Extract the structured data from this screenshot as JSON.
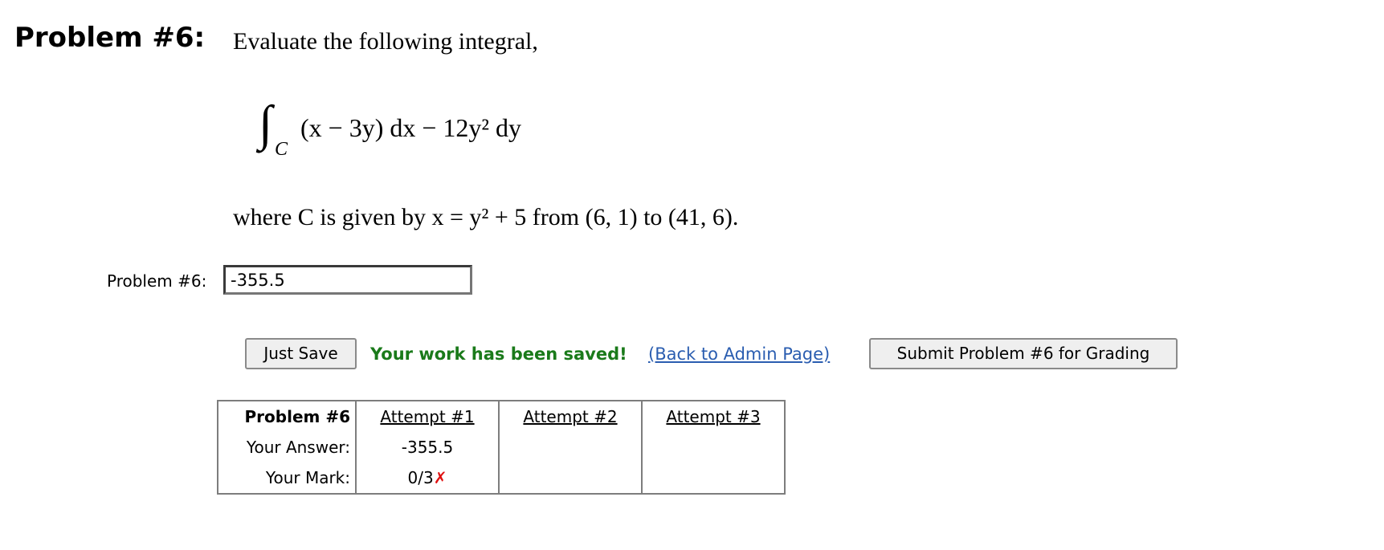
{
  "problem": {
    "heading": "Problem #6:",
    "intro": "Evaluate the following integral,",
    "integral": {
      "sign": "∫",
      "subscript": "C",
      "integrand_text": "(x − 3y) dx  −  12y² dy"
    },
    "where_text": "where C is given by  x  =  y² + 5  from (6, 1) to (41, 6)."
  },
  "answer": {
    "label": "Problem #6:",
    "value": "-355.5"
  },
  "actions": {
    "just_save_label": "Just Save",
    "saved_message": "Your work has been saved!",
    "admin_link_text": "(Back to Admin Page)",
    "submit_label": "Submit Problem #6 for Grading"
  },
  "attempts_table": {
    "header_label": "Problem #6",
    "attempts": [
      "Attempt #1",
      "Attempt #2",
      "Attempt #3"
    ],
    "answer_row_label": "Your Answer:",
    "mark_row_label": "Your Mark:",
    "answers": [
      "-355.5",
      "",
      ""
    ],
    "marks": [
      "0/3",
      "",
      ""
    ],
    "mark_symbols": [
      "✗",
      "",
      ""
    ]
  },
  "colors": {
    "saved_message": "#1a7a1a",
    "link": "#2a5db0",
    "incorrect_mark": "#e01010"
  },
  "icons": {
    "incorrect": "cross-mark-icon"
  }
}
